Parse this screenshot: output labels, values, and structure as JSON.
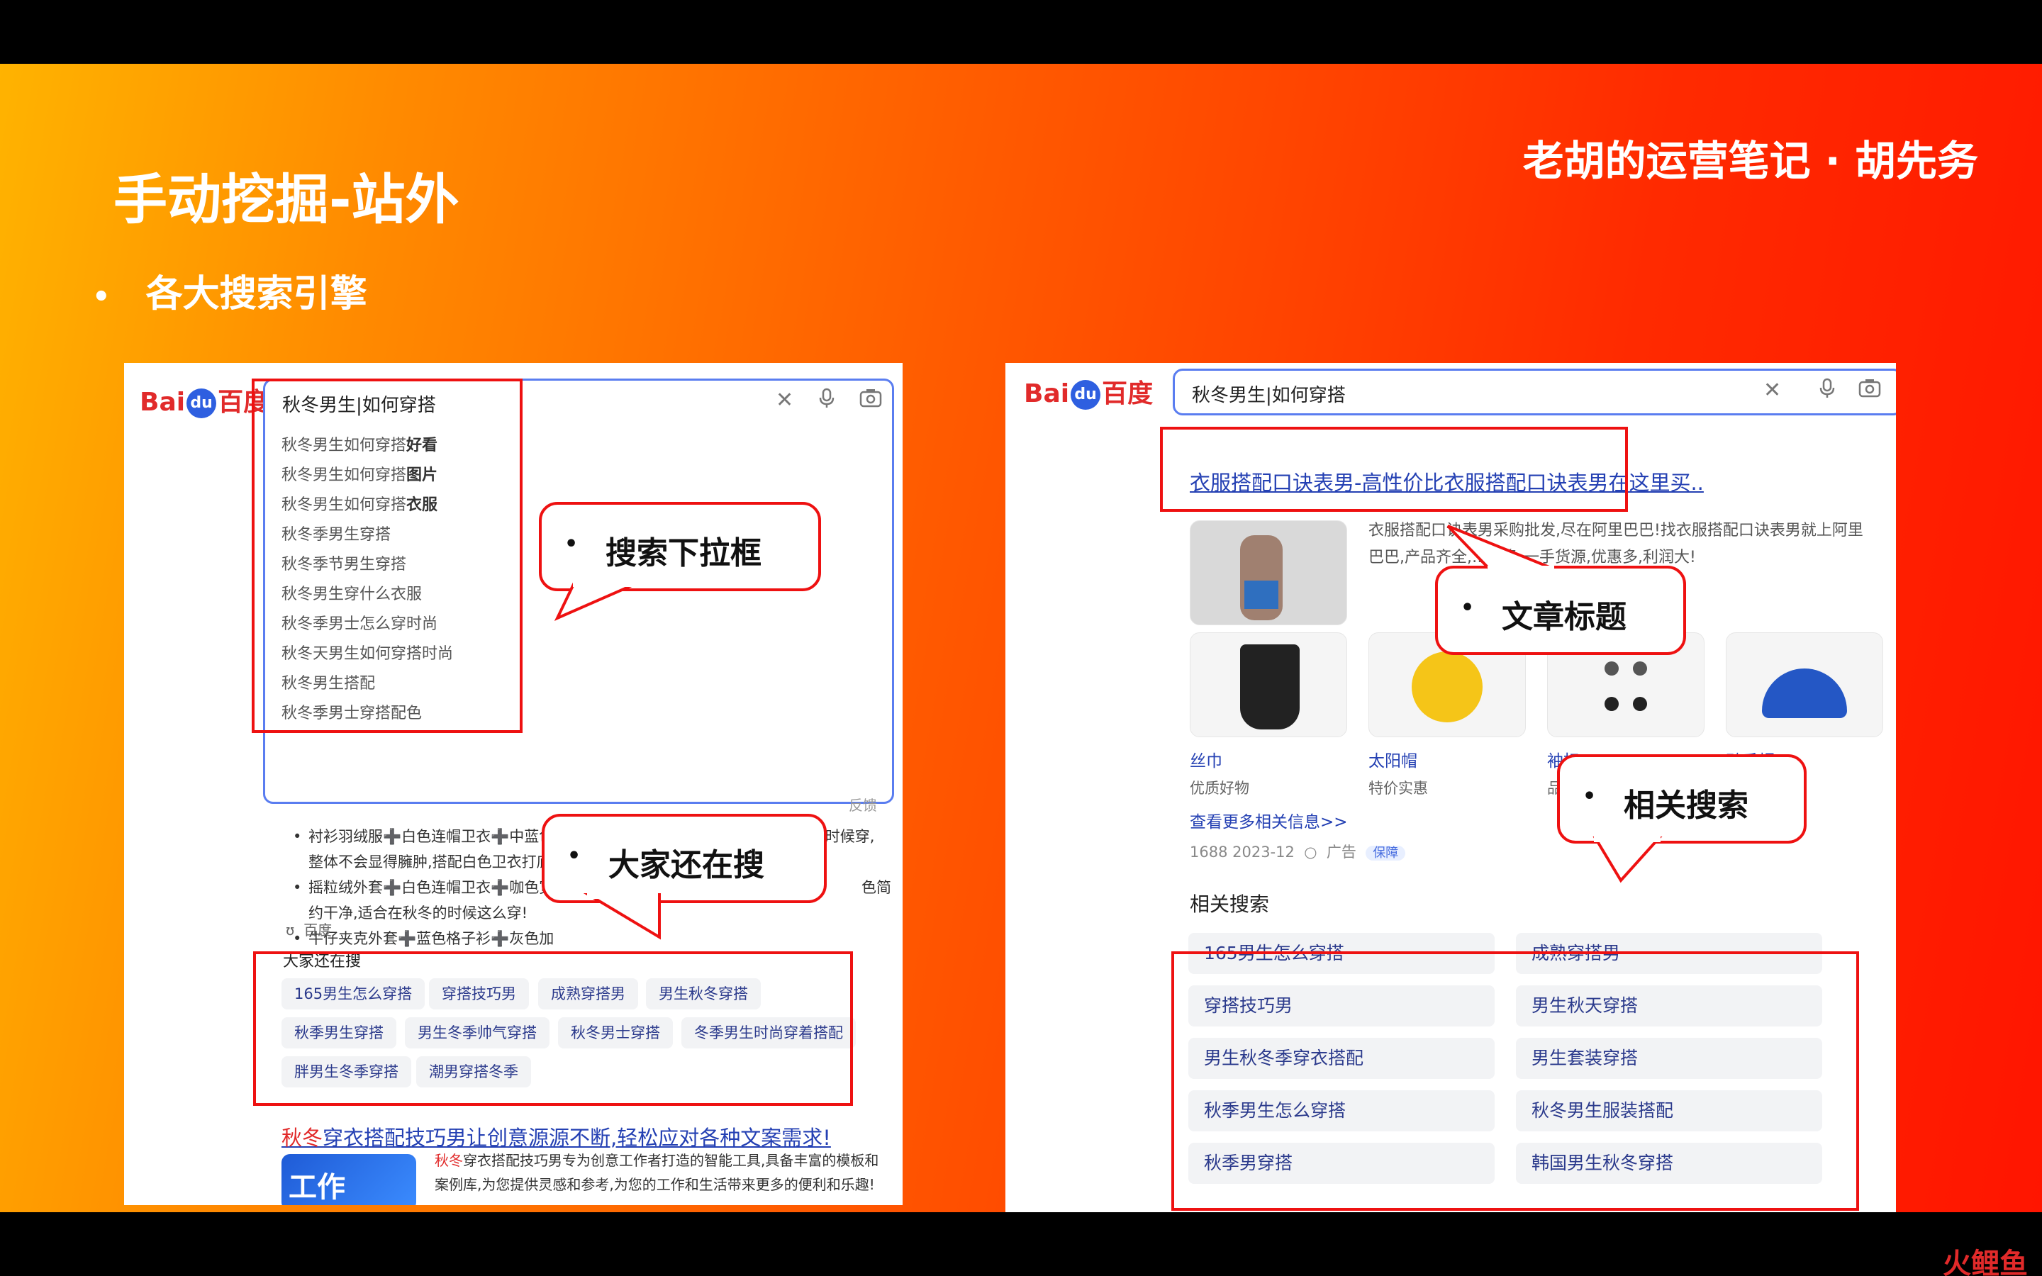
{
  "slide": {
    "title": "手动挖掘-站外",
    "brand": "老胡的运营笔记 · 胡先务",
    "bullet": "各大搜索引擎",
    "watermark": "火鲤鱼"
  },
  "left_panel": {
    "logo": {
      "bai": "Bai",
      "du": "du",
      "cn": "百度"
    },
    "query": "秋冬男生|如何穿搭",
    "suggestions": [
      {
        "base": "秋冬男生如何穿搭",
        "bold": "好看"
      },
      {
        "base": "秋冬男生如何穿搭",
        "bold": "图片"
      },
      {
        "base": "秋冬男生如何穿搭",
        "bold": "衣服"
      },
      {
        "base": "秋冬季男生穿搭",
        "bold": ""
      },
      {
        "base": "秋冬季节男生穿搭",
        "bold": ""
      },
      {
        "base": "秋冬男生穿什么衣服",
        "bold": ""
      },
      {
        "base": "秋冬季男士怎么穿时尚",
        "bold": ""
      },
      {
        "base": "秋冬天男生如何穿搭时尚",
        "bold": ""
      },
      {
        "base": "秋冬男生搭配",
        "bold": ""
      },
      {
        "base": "秋冬季男士穿搭配色",
        "bold": ""
      }
    ],
    "feedback": "反馈",
    "callout_dropdown": "搜索下拉框",
    "callout_also": "大家还在搜",
    "list": [
      "衬衫羽绒服➕白色连帽卫衣➕中蓝色牛仔裤 ❹轻薄的羽绒服夹克适合在初冬的时候穿,",
      "整体不会显得臃肿,搭配白色卫衣打底和蓝色牛仔裤,整体干净清新不沉闷!",
      "摇粒绒外套➕白色连帽卫衣➕咖色宽",
      "约干净,适合在秋冬的时候这么穿!",
      "牛仔夹克外套➕蓝色格子衫➕灰色加"
    ],
    "list_tail": "色简",
    "source": "百度",
    "also_heading": "大家还在搜",
    "also_tags": [
      "165男生怎么穿搭",
      "穿搭技巧男",
      "成熟穿搭男",
      "男生秋冬穿搭",
      "秋季男生穿搭",
      "男生冬季帅气穿搭",
      "秋冬男士穿搭",
      "冬季男生时尚穿着搭配",
      "胖男生冬季穿搭",
      "潮男穿搭冬季"
    ],
    "ad_title_hl": "秋冬",
    "ad_title_rest": "穿衣搭配技巧男让创意源源不断,轻松应对各种文案需求!",
    "ad_desc_hl": "秋冬",
    "ad_desc_1": "穿衣搭配技巧男专为创意工作者打造的智能工具,具备丰富的模板和",
    "ad_desc_2": "案例库,为您提供灵感和参考,为您的工作和生活带来更多的便利和乐趣!",
    "ad_thumb": "工作"
  },
  "right_panel": {
    "logo": {
      "bai": "Bai",
      "du": "du",
      "cn": "百度"
    },
    "query": "秋冬男生|如何穿搭",
    "ad_title": "衣服搭配口诀表男-高性价比衣服搭配口诀表男在这里买..",
    "ad_desc_1": "衣服搭配口诀表男采购批发,尽在阿里巴巴!找衣服搭配口诀表男就上阿里",
    "ad_desc_2": "巴巴,产品齐全,…众多,一手货源,优惠多,利润大!",
    "callout_title": "文章标题",
    "callout_related": "相关搜索",
    "products": [
      {
        "name": "丝巾",
        "sub": "优质好物"
      },
      {
        "name": "太阳帽",
        "sub": "特价实惠"
      },
      {
        "name": "袖扣",
        "sub": "品"
      },
      {
        "name": "鸭舌帽",
        "sub": ""
      }
    ],
    "more_link": "查看更多相关信息>>",
    "meta": "1688 2023-12",
    "meta_ad": "广告",
    "meta_badge": "保障",
    "related_heading": "相关搜索",
    "related": [
      [
        "165男生怎么穿搭",
        "成熟穿搭男"
      ],
      [
        "穿搭技巧男",
        "男生秋天穿搭"
      ],
      [
        "男生秋冬季穿衣搭配",
        "男生套装穿搭"
      ],
      [
        "秋季男生怎么穿搭",
        "秋冬男生服装搭配"
      ],
      [
        "秋季男穿搭",
        "韩国男生秋冬穿搭"
      ]
    ]
  }
}
